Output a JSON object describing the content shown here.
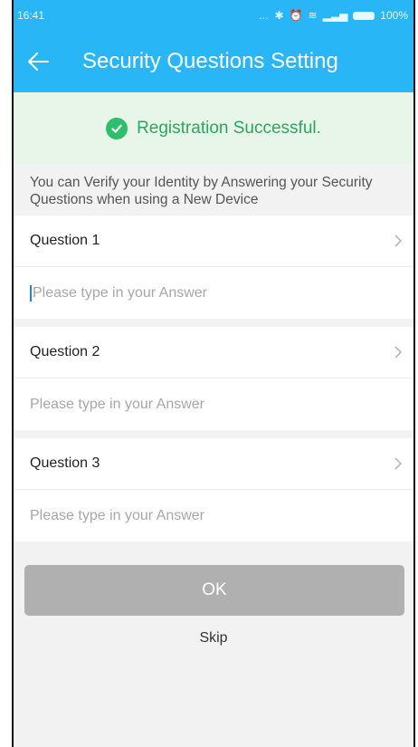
{
  "status_bar": {
    "time": "16:41",
    "battery_text": "100%"
  },
  "app_bar": {
    "title": "Security Questions Setting",
    "back_icon": "back-arrow-icon"
  },
  "banner": {
    "text": "Registration Successful.",
    "icon": "check-circle-icon",
    "color": "#2ebf6d"
  },
  "info": {
    "line1": "You can Verify your Identity by Answering your Security",
    "line2": "Questions when using a New Device"
  },
  "questions": [
    {
      "label": "Question 1",
      "answer_value": "",
      "placeholder": "Please type in your Answer"
    },
    {
      "label": "Question 2",
      "answer_value": "",
      "placeholder": "Please type in your Answer"
    },
    {
      "label": "Question 3",
      "answer_value": "",
      "placeholder": "Please type in your Answer"
    }
  ],
  "actions": {
    "ok_label": "OK",
    "skip_label": "Skip"
  },
  "colors": {
    "accent": "#29b6f6",
    "success": "#2ebf6d",
    "button_disabled": "#b0b0b0"
  }
}
